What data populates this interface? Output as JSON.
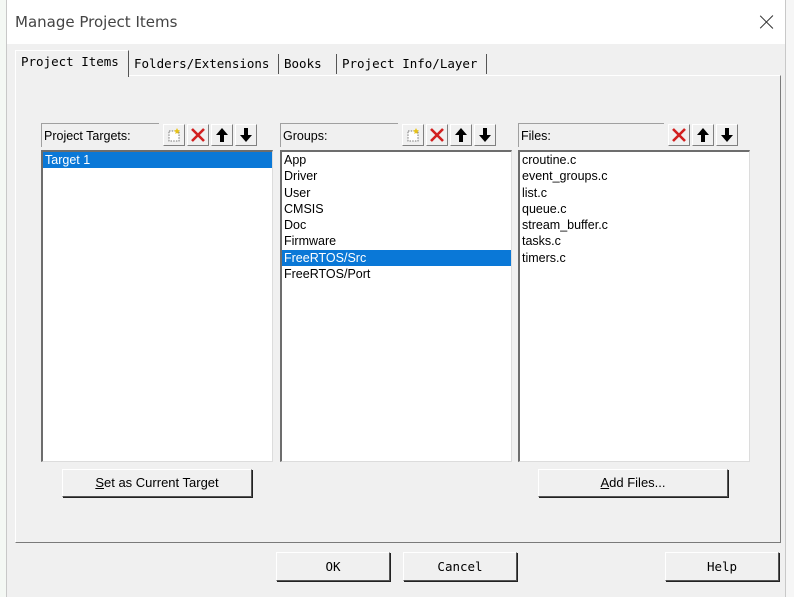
{
  "window": {
    "title": "Manage Project Items"
  },
  "tabs": [
    {
      "label": "Project Items",
      "active": true
    },
    {
      "label": "Folders/Extensions",
      "active": false
    },
    {
      "label": "Books",
      "active": false
    },
    {
      "label": "Project Info/Layer",
      "active": false
    }
  ],
  "targets": {
    "label": "Project Targets:",
    "items": [
      {
        "label": "Target 1",
        "selected": true
      }
    ]
  },
  "groups": {
    "label": "Groups:",
    "items": [
      {
        "label": "App",
        "selected": false
      },
      {
        "label": "Driver",
        "selected": false
      },
      {
        "label": "User",
        "selected": false
      },
      {
        "label": "CMSIS",
        "selected": false
      },
      {
        "label": "Doc",
        "selected": false
      },
      {
        "label": "Firmware",
        "selected": false
      },
      {
        "label": "FreeRTOS/Src",
        "selected": true
      },
      {
        "label": "FreeRTOS/Port",
        "selected": false
      }
    ]
  },
  "files": {
    "label": "Files:",
    "items": [
      {
        "label": "croutine.c"
      },
      {
        "label": "event_groups.c"
      },
      {
        "label": "list.c"
      },
      {
        "label": "queue.c"
      },
      {
        "label": "stream_buffer.c"
      },
      {
        "label": "tasks.c"
      },
      {
        "label": "timers.c"
      }
    ]
  },
  "buttons": {
    "set_current_first": "S",
    "set_current_rest": "et as Current Target",
    "add_files_first": "A",
    "add_files_rest": "dd Files...",
    "ok": "OK",
    "cancel": "Cancel",
    "help": "Help"
  },
  "icons": {
    "new": "new-item-icon",
    "delete": "delete-icon",
    "up": "move-up-icon",
    "down": "move-down-icon"
  },
  "colors": {
    "selection": "#0a78d7",
    "delete": "#d21f1f"
  }
}
